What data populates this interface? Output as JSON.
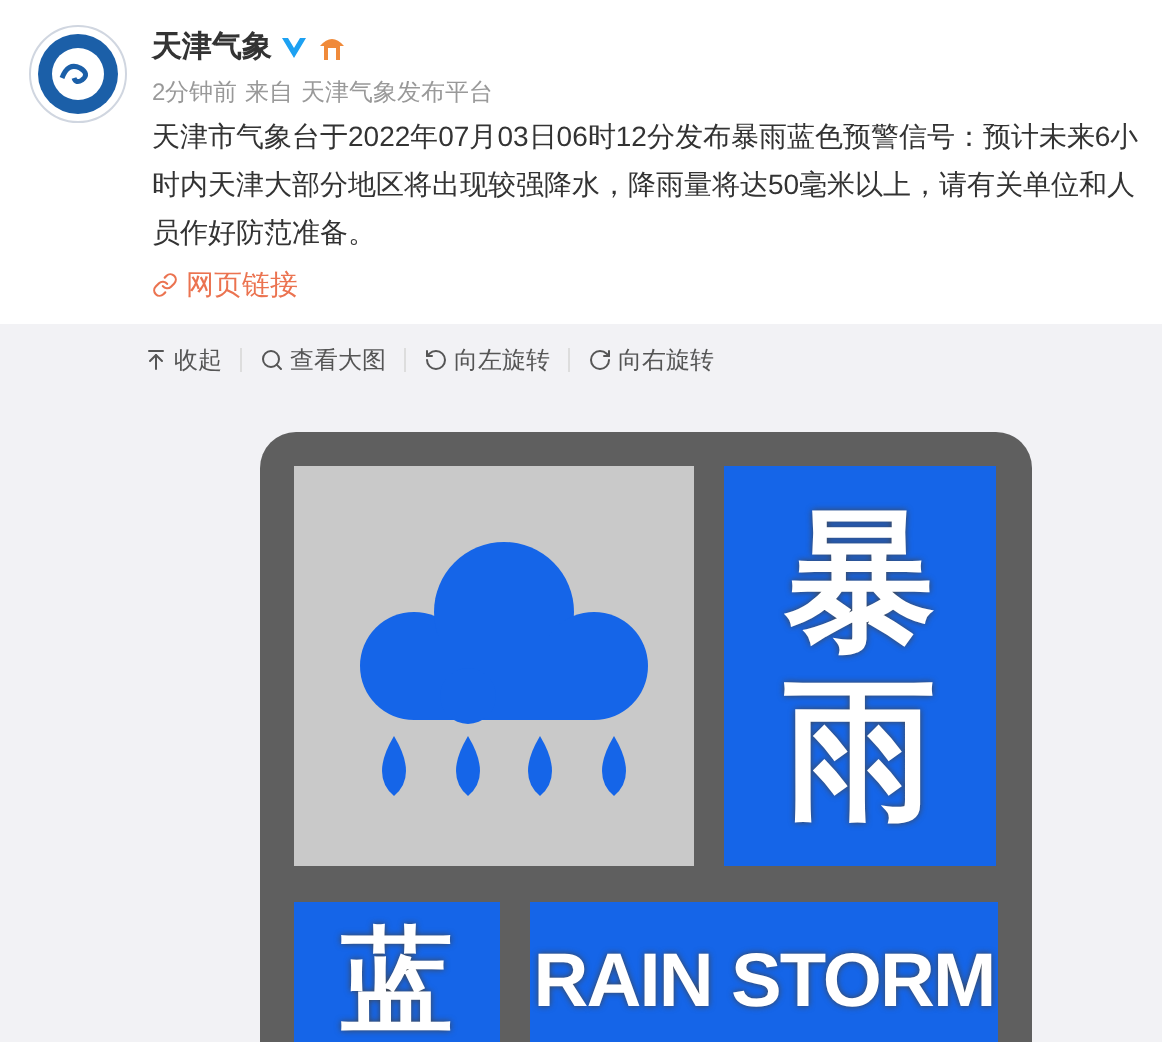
{
  "post": {
    "author": "天津气象",
    "time": "2分钟前",
    "from_label": "来自",
    "source": "天津气象发布平台",
    "text": "天津市气象台于2022年07月03日06时12分发布暴雨蓝色预警信号：预计未来6小时内天津大部分地区将出现较强降水，降雨量将达50毫米以上，请有关单位和人员作好防范准备。",
    "link": "网页链接"
  },
  "toolbar": [
    {
      "kind": "collapse",
      "label": "收起"
    },
    {
      "kind": "zoom",
      "label": "查看大图"
    },
    {
      "kind": "rotate_left",
      "label": "向左旋转"
    },
    {
      "kind": "rotate_right",
      "label": "向右旋转"
    }
  ],
  "sign": {
    "title": "暴雨",
    "level": "蓝",
    "english": "RAIN STORM"
  }
}
